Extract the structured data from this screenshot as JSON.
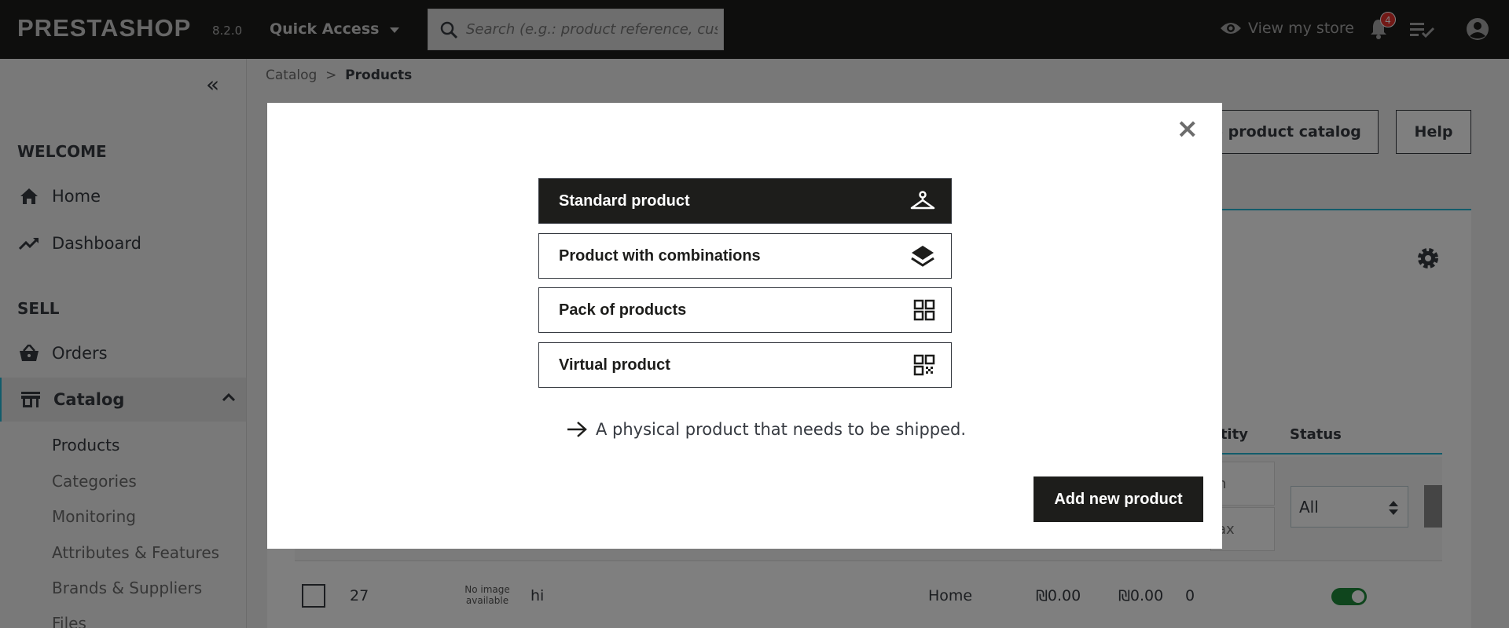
{
  "topbar": {
    "logo": "PRESTASHOP",
    "version": "8.2.0",
    "quick_access": "Quick Access",
    "search_placeholder": "Search (e.g.: product reference, custon",
    "view_store": "View my store",
    "notification_count": "4"
  },
  "sidebar": {
    "collapse_icon": "«",
    "welcome_title": "WELCOME",
    "home": "Home",
    "dashboard": "Dashboard",
    "sell_title": "SELL",
    "orders": "Orders",
    "catalog": "Catalog",
    "sub": {
      "products": "Products",
      "categories": "Categories",
      "monitoring": "Monitoring",
      "attributes": "Attributes & Features",
      "brands": "Brands & Suppliers",
      "files": "Files"
    }
  },
  "breadcrumb": {
    "parent": "Catalog",
    "separator": ">",
    "current": "Products"
  },
  "header": {
    "catalog_btn": "ze product catalog",
    "help_btn": "Help"
  },
  "table": {
    "col_quantity": "ntity",
    "col_status": "Status",
    "filter_min": "n",
    "filter_max": "ax",
    "status_select": "All",
    "row": {
      "id": "27",
      "no_image": "No image available",
      "name": "hi",
      "category": "Home",
      "price_ex": "₪0.00",
      "price_in": "₪0.00",
      "quantity": "0",
      "active": true
    }
  },
  "modal": {
    "close": "×",
    "options": [
      {
        "label": "Standard product",
        "icon": "hanger-icon",
        "selected": true
      },
      {
        "label": "Product with combinations",
        "icon": "layers-icon",
        "selected": false
      },
      {
        "label": "Pack of products",
        "icon": "grid-icon",
        "selected": false
      },
      {
        "label": "Virtual product",
        "icon": "qr-code-icon",
        "selected": false
      }
    ],
    "description": "A physical product that needs to be shipped.",
    "add_button": "Add new product"
  },
  "colors": {
    "topbar": "#1d1d1b",
    "accent": "#25b9d7",
    "badge": "#e4322d",
    "toggle_on": "#1f8a3b"
  }
}
